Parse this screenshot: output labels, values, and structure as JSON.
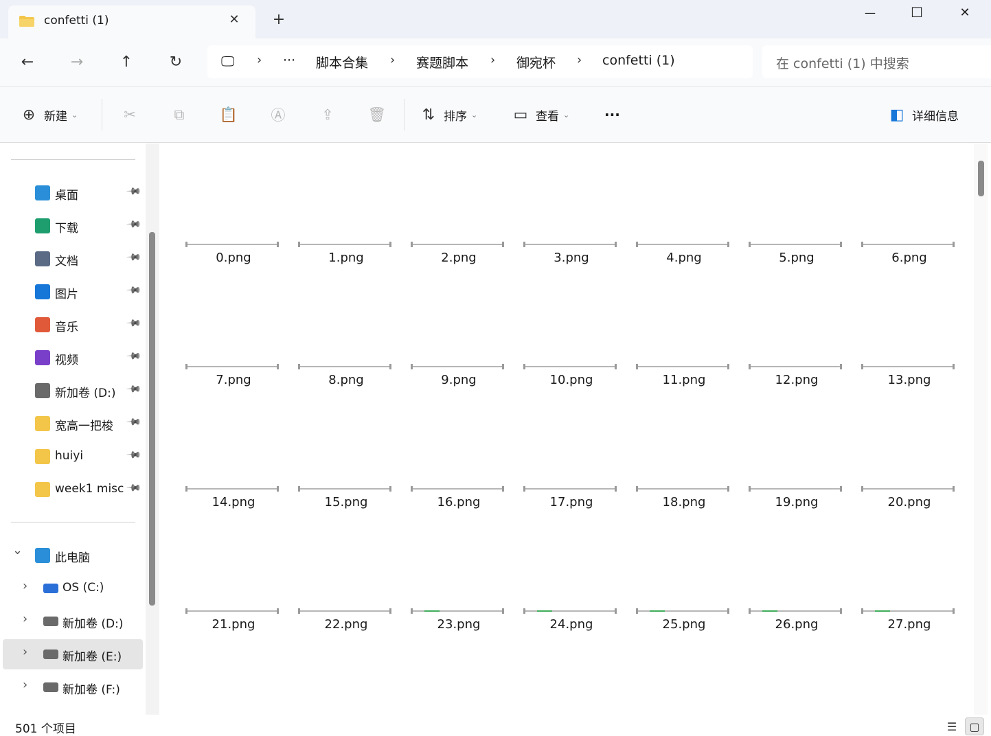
{
  "window": {
    "tab_title": "confetti (1)",
    "tab_close": "✕",
    "new_tab": "+",
    "minimize": "—",
    "maximize": "☐",
    "close": "✕"
  },
  "nav": {
    "back": "←",
    "forward": "→",
    "up": "↑",
    "refresh": "↻",
    "computer_icon": "🖵",
    "more_crumbs": "···",
    "separator": "›",
    "breadcrumbs": [
      "脚本合集",
      "赛题脚本",
      "御宛杯",
      "confetti (1)"
    ],
    "search_placeholder": "在 confetti (1) 中搜索"
  },
  "toolbar": {
    "new_label": "新建",
    "sort_label": "排序",
    "view_label": "查看",
    "more_label": "···",
    "details_label": "详细信息",
    "icons": {
      "new": "⊕",
      "cut": "✂",
      "copy": "⧉",
      "paste": "📋",
      "rename": "Ⓐ",
      "share": "⇪",
      "delete": "🗑",
      "sort": "⇅",
      "view": "▭",
      "details": "◧"
    }
  },
  "sidebar": {
    "pin_glyph": "📌",
    "expand_glyph": "›",
    "collapse_glyph": "⌄",
    "quick_access": [
      {
        "label": "桌面",
        "icon": "desktop-icon",
        "color": "#2a8fd8"
      },
      {
        "label": "下载",
        "icon": "download-icon",
        "color": "#1e9e6e"
      },
      {
        "label": "文档",
        "icon": "document-icon",
        "color": "#5b6b86"
      },
      {
        "label": "图片",
        "icon": "pictures-icon",
        "color": "#1677d8"
      },
      {
        "label": "音乐",
        "icon": "music-icon",
        "color": "#e05a3a"
      },
      {
        "label": "视频",
        "icon": "video-icon",
        "color": "#7a3fc9"
      },
      {
        "label": "新加卷 (D:)",
        "icon": "drive-icon",
        "color": "#6a6a6a"
      },
      {
        "label": "宽高一把梭",
        "icon": "folder-icon",
        "color": "#f3c64a"
      },
      {
        "label": "huiyi",
        "icon": "folder-icon",
        "color": "#f3c64a"
      },
      {
        "label": "week1 misc",
        "icon": "folder-icon",
        "color": "#f3c64a"
      }
    ],
    "this_pc": {
      "label": "此电脑",
      "icon": "computer-icon",
      "color": "#2a8fd8"
    },
    "drives": [
      {
        "label": "OS (C:)",
        "icon": "windows-drive-icon",
        "color": "#2a6fd8"
      },
      {
        "label": "新加卷 (D:)",
        "icon": "drive-icon",
        "color": "#6a6a6a"
      },
      {
        "label": "新加卷 (E:)",
        "icon": "drive-icon",
        "color": "#6a6a6a"
      },
      {
        "label": "新加卷 (F:)",
        "icon": "drive-icon",
        "color": "#6a6a6a"
      }
    ]
  },
  "files": [
    {
      "name": "0.png",
      "green": false
    },
    {
      "name": "1.png",
      "green": false
    },
    {
      "name": "2.png",
      "green": false
    },
    {
      "name": "3.png",
      "green": false
    },
    {
      "name": "4.png",
      "green": false
    },
    {
      "name": "5.png",
      "green": false
    },
    {
      "name": "6.png",
      "green": false
    },
    {
      "name": "7.png",
      "green": false
    },
    {
      "name": "8.png",
      "green": false
    },
    {
      "name": "9.png",
      "green": false
    },
    {
      "name": "10.png",
      "green": false
    },
    {
      "name": "11.png",
      "green": false
    },
    {
      "name": "12.png",
      "green": false
    },
    {
      "name": "13.png",
      "green": false
    },
    {
      "name": "14.png",
      "green": false
    },
    {
      "name": "15.png",
      "green": false
    },
    {
      "name": "16.png",
      "green": false
    },
    {
      "name": "17.png",
      "green": false
    },
    {
      "name": "18.png",
      "green": false
    },
    {
      "name": "19.png",
      "green": false
    },
    {
      "name": "20.png",
      "green": false
    },
    {
      "name": "21.png",
      "green": false
    },
    {
      "name": "22.png",
      "green": false
    },
    {
      "name": "23.png",
      "green": true
    },
    {
      "name": "24.png",
      "green": true
    },
    {
      "name": "25.png",
      "green": true
    },
    {
      "name": "26.png",
      "green": true
    },
    {
      "name": "27.png",
      "green": true
    }
  ],
  "status": {
    "item_count": "501 个项目",
    "list_view_glyph": "☰",
    "tile_view_glyph": "▢"
  }
}
